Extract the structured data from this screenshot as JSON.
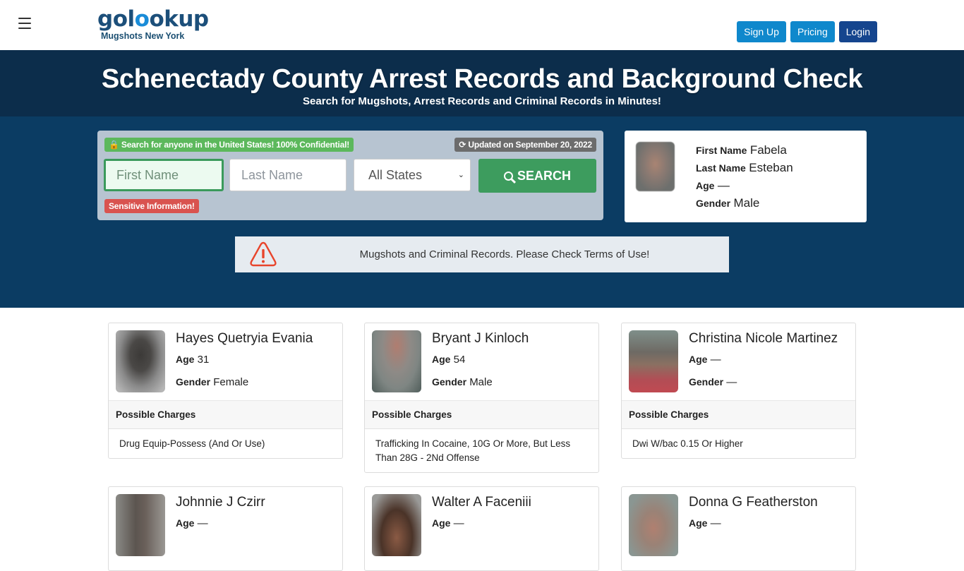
{
  "header": {
    "logo_text_pre": "gol",
    "logo_text_accent": "o",
    "logo_text_post": "okup",
    "logo_subtitle": "Mugshots New York",
    "menu_icon": "hamburger-menu-icon",
    "nav": {
      "signup": "Sign Up",
      "pricing": "Pricing",
      "login": "Login"
    }
  },
  "hero": {
    "title": "Schenectady County Arrest Records and Background Check",
    "subtitle": "Search for Mugshots, Arrest Records and Criminal Records in Minutes!"
  },
  "search": {
    "confidential_badge": "Search for anyone in the United States! 100% Confidential!",
    "updated_badge": "Updated on September 20, 2022",
    "first_name_placeholder": "First Name",
    "last_name_placeholder": "Last Name",
    "state_selected": "All States",
    "search_button": "SEARCH",
    "sensitive_badge": "Sensitive Information!"
  },
  "featured_person": {
    "first_name_label": "First Name",
    "first_name": "Fabela",
    "last_name_label": "Last Name",
    "last_name": "Esteban",
    "age_label": "Age",
    "age": "—",
    "gender_label": "Gender",
    "gender": "Male"
  },
  "notice": {
    "text": "Mugshots and Criminal Records. Please Check Terms of Use!"
  },
  "records": [
    {
      "name": "Hayes Quetryia Evania",
      "age_label": "Age",
      "age": "31",
      "gender_label": "Gender",
      "gender": "Female",
      "charges_label": "Possible Charges",
      "charges": "Drug Equip-Possess (And Or Use)"
    },
    {
      "name": "Bryant J Kinloch",
      "age_label": "Age",
      "age": "54",
      "gender_label": "Gender",
      "gender": "Male",
      "charges_label": "Possible Charges",
      "charges": "Trafficking In Cocaine, 10G Or More, But Less Than 28G - 2Nd Offense"
    },
    {
      "name": "Christina Nicole Martinez",
      "age_label": "Age",
      "age": "—",
      "gender_label": "Gender",
      "gender": "—",
      "charges_label": "Possible Charges",
      "charges": "Dwi W/bac 0.15 Or Higher"
    },
    {
      "name": "Johnnie J Czirr",
      "age_label": "Age",
      "age": "—"
    },
    {
      "name": "Walter A Faceniii",
      "age_label": "Age",
      "age": "—"
    },
    {
      "name": "Donna G Featherston",
      "age_label": "Age",
      "age": "—"
    }
  ]
}
